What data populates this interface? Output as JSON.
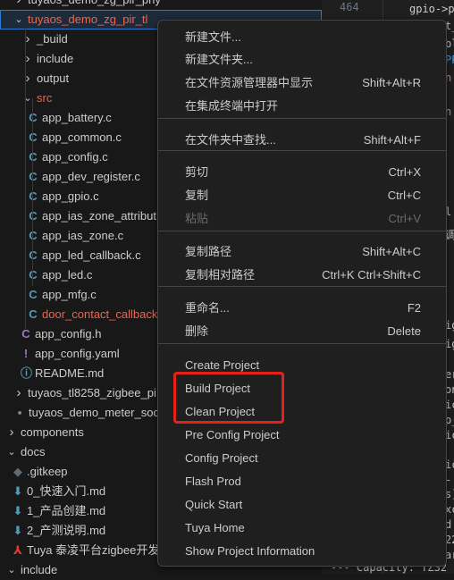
{
  "explorer": {
    "items": [
      {
        "label": "tuyaos_demo_zg_pir_phy",
        "type": "folder",
        "state": "collapsed"
      },
      {
        "label": "tuyaos_demo_zg_pir_tl",
        "type": "folder",
        "state": "expanded",
        "modified": true,
        "selected": true
      },
      {
        "label": "_build",
        "type": "folder",
        "state": "collapsed"
      },
      {
        "label": "include",
        "type": "folder",
        "state": "collapsed"
      },
      {
        "label": "output",
        "type": "folder",
        "state": "collapsed"
      },
      {
        "label": "src",
        "type": "folder",
        "state": "expanded",
        "modified": true
      },
      {
        "label": "app_battery.c",
        "type": "c"
      },
      {
        "label": "app_common.c",
        "type": "c"
      },
      {
        "label": "app_config.c",
        "type": "c"
      },
      {
        "label": "app_dev_register.c",
        "type": "c"
      },
      {
        "label": "app_gpio.c",
        "type": "c"
      },
      {
        "label": "app_ias_zone_attribut",
        "type": "c"
      },
      {
        "label": "app_ias_zone.c",
        "type": "c"
      },
      {
        "label": "app_led_callback.c",
        "type": "c"
      },
      {
        "label": "app_led.c",
        "type": "c"
      },
      {
        "label": "app_mfg.c",
        "type": "c"
      },
      {
        "label": "door_contact_callback",
        "type": "c",
        "modified": true
      },
      {
        "label": "app_config.h",
        "type": "h"
      },
      {
        "label": "app_config.yaml",
        "type": "yaml"
      },
      {
        "label": "README.md",
        "type": "info"
      },
      {
        "label": "tuyaos_tl8258_zigbee_pi",
        "type": "folder",
        "state": "collapsed"
      },
      {
        "label": "tuyaos_demo_meter_soc",
        "type": "file"
      },
      {
        "label": "components",
        "type": "folder",
        "state": "collapsed"
      },
      {
        "label": "docs",
        "type": "folder",
        "state": "expanded"
      },
      {
        "label": ".gitkeep",
        "type": "git"
      },
      {
        "label": "0_快速入门.md",
        "type": "md"
      },
      {
        "label": "1_产品创建.md",
        "type": "md"
      },
      {
        "label": "2_产测说明.md",
        "type": "md"
      },
      {
        "label": "Tuya 泰凌平台zigbee开发",
        "type": "pdf"
      },
      {
        "label": "include",
        "type": "folder",
        "state": "expanded"
      }
    ]
  },
  "editor": {
    "line_number": "464",
    "code_fragments": [
      "gpio->p",
      "t_",
      "bl",
      "PP",
      "n",
      "n",
      "l",
      "调",
      "ig",
      "ig",
      "er",
      "on",
      "ic",
      "p_",
      "ic",
      "ic",
      " -",
      "s]",
      "xc",
      "d",
      "22",
      "ar"
    ],
    "status_line": "--- Capacity: TZ32"
  },
  "context_menu": {
    "items": [
      {
        "label": "新建文件...",
        "shortcut": ""
      },
      {
        "label": "新建文件夹...",
        "shortcut": ""
      },
      {
        "label": "在文件资源管理器中显示",
        "shortcut": "Shift+Alt+R"
      },
      {
        "label": "在集成终端中打开",
        "shortcut": ""
      },
      {
        "label": "在文件夹中查找...",
        "shortcut": "Shift+Alt+F"
      },
      {
        "label": "剪切",
        "shortcut": "Ctrl+X"
      },
      {
        "label": "复制",
        "shortcut": "Ctrl+C"
      },
      {
        "label": "粘贴",
        "shortcut": "Ctrl+V",
        "disabled": true
      },
      {
        "label": "复制路径",
        "shortcut": "Shift+Alt+C"
      },
      {
        "label": "复制相对路径",
        "shortcut": "Ctrl+K Ctrl+Shift+C"
      },
      {
        "label": "重命名...",
        "shortcut": "F2"
      },
      {
        "label": "删除",
        "shortcut": "Delete"
      },
      {
        "label": "Create Project",
        "shortcut": ""
      },
      {
        "label": "Build Project",
        "shortcut": "",
        "highlighted": true
      },
      {
        "label": "Clean Project",
        "shortcut": "",
        "highlighted": true
      },
      {
        "label": "Pre Config Project",
        "shortcut": ""
      },
      {
        "label": "Config Project",
        "shortcut": ""
      },
      {
        "label": "Flash Prod",
        "shortcut": ""
      },
      {
        "label": "Quick Start",
        "shortcut": ""
      },
      {
        "label": "Tuya Home",
        "shortcut": ""
      },
      {
        "label": "Show Project Information",
        "shortcut": ""
      }
    ]
  },
  "colors": {
    "highlight_box": "#e8201a",
    "modified": "#f0644e",
    "c_icon": "#519aba",
    "h_icon": "#a074c4"
  }
}
